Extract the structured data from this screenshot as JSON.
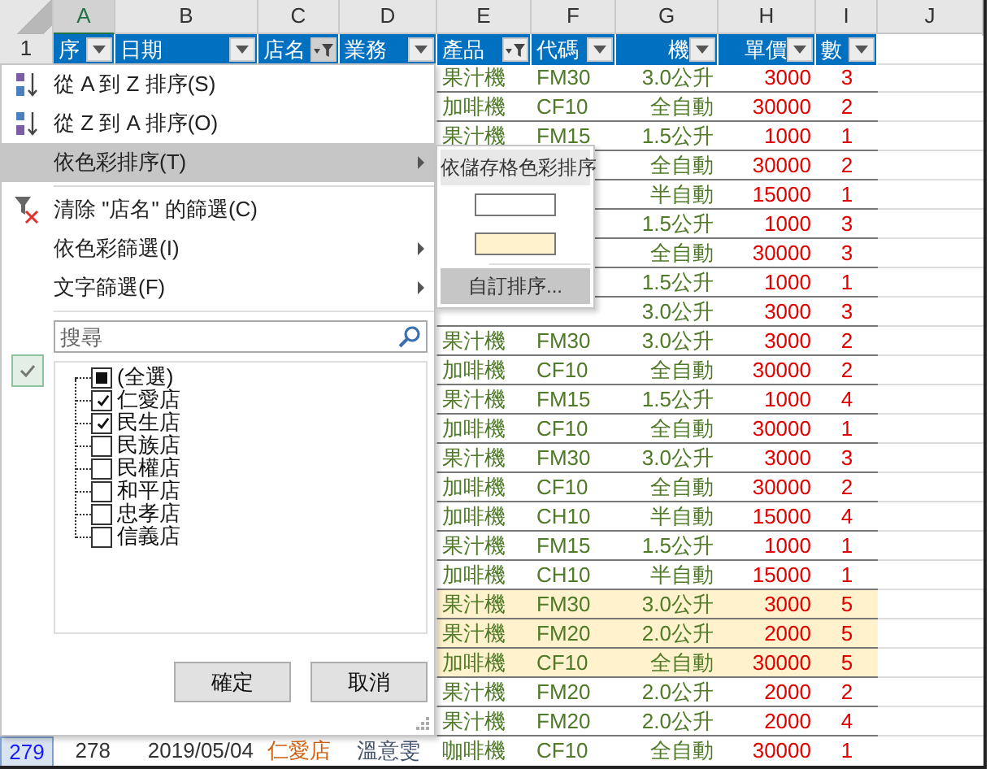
{
  "column_headers": [
    {
      "letter": "A",
      "selected": true
    },
    {
      "letter": "B",
      "selected": false
    },
    {
      "letter": "C",
      "selected": false
    },
    {
      "letter": "D",
      "selected": false
    },
    {
      "letter": "E",
      "selected": false
    },
    {
      "letter": "F",
      "selected": false
    },
    {
      "letter": "G",
      "selected": false
    },
    {
      "letter": "H",
      "selected": false
    },
    {
      "letter": "I",
      "selected": false
    },
    {
      "letter": "J",
      "selected": false
    }
  ],
  "header_row": {
    "row_number": "1",
    "cells": [
      {
        "label": "序",
        "filtered": false,
        "open": false
      },
      {
        "label": "日期",
        "filtered": false,
        "open": false
      },
      {
        "label": "店名",
        "filtered": true,
        "open": true
      },
      {
        "label": "業務",
        "filtered": false,
        "open": false
      },
      {
        "label": "產品",
        "filtered": true,
        "open": false
      },
      {
        "label": "代碼",
        "filtered": false,
        "open": false
      },
      {
        "label": "機",
        "filtered": false,
        "open": false
      },
      {
        "label": "單價",
        "filtered": false,
        "open": false
      },
      {
        "label": "數",
        "filtered": false,
        "open": false
      }
    ]
  },
  "rows": [
    {
      "product": "果汁機",
      "code": "FM30",
      "spec": "3.0公升",
      "price": "3000",
      "qty": "3",
      "highlighted": false
    },
    {
      "product": "加啡機",
      "code": "CF10",
      "spec": "全自動",
      "price": "30000",
      "qty": "2",
      "highlighted": false
    },
    {
      "product": "果汁機",
      "code": "FM15",
      "spec": "1.5公升",
      "price": "1000",
      "qty": "1",
      "highlighted": false
    },
    {
      "spec": "全自動",
      "price": "30000",
      "qty": "2",
      "highlighted": false
    },
    {
      "spec": "半自動",
      "price": "15000",
      "qty": "1",
      "highlighted": false
    },
    {
      "spec": "1.5公升",
      "price": "1000",
      "qty": "3",
      "highlighted": false
    },
    {
      "spec": "全自動",
      "price": "30000",
      "qty": "3",
      "highlighted": false
    },
    {
      "spec": "1.5公升",
      "price": "1000",
      "qty": "1",
      "highlighted": false
    },
    {
      "spec": "3.0公升",
      "price": "3000",
      "qty": "3",
      "highlighted": false
    },
    {
      "product": "果汁機",
      "code": "FM30",
      "spec": "3.0公升",
      "price": "3000",
      "qty": "2",
      "highlighted": false
    },
    {
      "product": "加啡機",
      "code": "CF10",
      "spec": "全自動",
      "price": "30000",
      "qty": "2",
      "highlighted": false
    },
    {
      "product": "果汁機",
      "code": "FM15",
      "spec": "1.5公升",
      "price": "1000",
      "qty": "4",
      "highlighted": false
    },
    {
      "product": "加啡機",
      "code": "CF10",
      "spec": "全自動",
      "price": "30000",
      "qty": "1",
      "highlighted": false
    },
    {
      "product": "果汁機",
      "code": "FM30",
      "spec": "3.0公升",
      "price": "3000",
      "qty": "3",
      "highlighted": false
    },
    {
      "product": "加啡機",
      "code": "CF10",
      "spec": "全自動",
      "price": "30000",
      "qty": "2",
      "highlighted": false
    },
    {
      "product": "加啡機",
      "code": "CH10",
      "spec": "半自動",
      "price": "15000",
      "qty": "4",
      "highlighted": false
    },
    {
      "product": "果汁機",
      "code": "FM15",
      "spec": "1.5公升",
      "price": "1000",
      "qty": "1",
      "highlighted": false
    },
    {
      "product": "加啡機",
      "code": "CH10",
      "spec": "半自動",
      "price": "15000",
      "qty": "1",
      "highlighted": false
    },
    {
      "product": "果汁機",
      "code": "FM30",
      "spec": "3.0公升",
      "price": "3000",
      "qty": "5",
      "highlighted": true
    },
    {
      "product": "果汁機",
      "code": "FM20",
      "spec": "2.0公升",
      "price": "2000",
      "qty": "5",
      "highlighted": true
    },
    {
      "product": "加啡機",
      "code": "CF10",
      "spec": "全自動",
      "price": "30000",
      "qty": "5",
      "highlighted": true
    },
    {
      "product": "果汁機",
      "code": "FM20",
      "spec": "2.0公升",
      "price": "2000",
      "qty": "2",
      "highlighted": false
    },
    {
      "product": "果汁機",
      "code": "FM20",
      "spec": "2.0公升",
      "price": "2000",
      "qty": "4",
      "highlighted": false
    }
  ],
  "bottom_row": {
    "row_number": "279",
    "selected": true,
    "seq": "278",
    "date": "2019/05/04",
    "store": "仁愛店",
    "staff": "溫意雯",
    "product": "咖啡機",
    "code": "CF10",
    "spec": "全自動",
    "price": "30000",
    "qty": "1",
    "highlighted": false
  },
  "filter_menu": {
    "items": [
      {
        "kind": "sort_az",
        "label": "從 A 到 Z 排序(S)",
        "selected": false,
        "submenu": false,
        "separator_before": false
      },
      {
        "kind": "sort_za",
        "label": "從 Z 到 A 排序(O)",
        "selected": false,
        "submenu": false,
        "separator_before": false
      },
      {
        "kind": "plain",
        "label": "依色彩排序(T)",
        "selected": true,
        "submenu": true,
        "separator_before": false
      },
      {
        "kind": "clear_filter",
        "label": "清除 \"店名\" 的篩選(C)",
        "selected": false,
        "submenu": false,
        "separator_before": true
      },
      {
        "kind": "plain",
        "label": "依色彩篩選(I)",
        "selected": false,
        "submenu": true,
        "separator_before": false
      },
      {
        "kind": "plain",
        "label": "文字篩選(F)",
        "selected": false,
        "submenu": true,
        "separator_before": false
      }
    ],
    "text_filter_active": true,
    "search": {
      "placeholder": "搜尋"
    },
    "select_all": {
      "label": "(全選)",
      "mixed": true
    },
    "values": [
      {
        "label": "仁愛店",
        "checked": true
      },
      {
        "label": "民生店",
        "checked": true
      },
      {
        "label": "民族店",
        "checked": false
      },
      {
        "label": "民權店",
        "checked": false
      },
      {
        "label": "和平店",
        "checked": false
      },
      {
        "label": "忠孝店",
        "checked": false
      },
      {
        "label": "信義店",
        "checked": false
      }
    ],
    "buttons": [
      "確定",
      "取消"
    ]
  },
  "color_submenu": {
    "title": "依儲存格色彩排序",
    "swatches": [
      {
        "color": "#ffffff"
      },
      {
        "color": "#fff2cc"
      }
    ],
    "custom_sort": {
      "label": "自訂排序...",
      "selected": true
    }
  }
}
